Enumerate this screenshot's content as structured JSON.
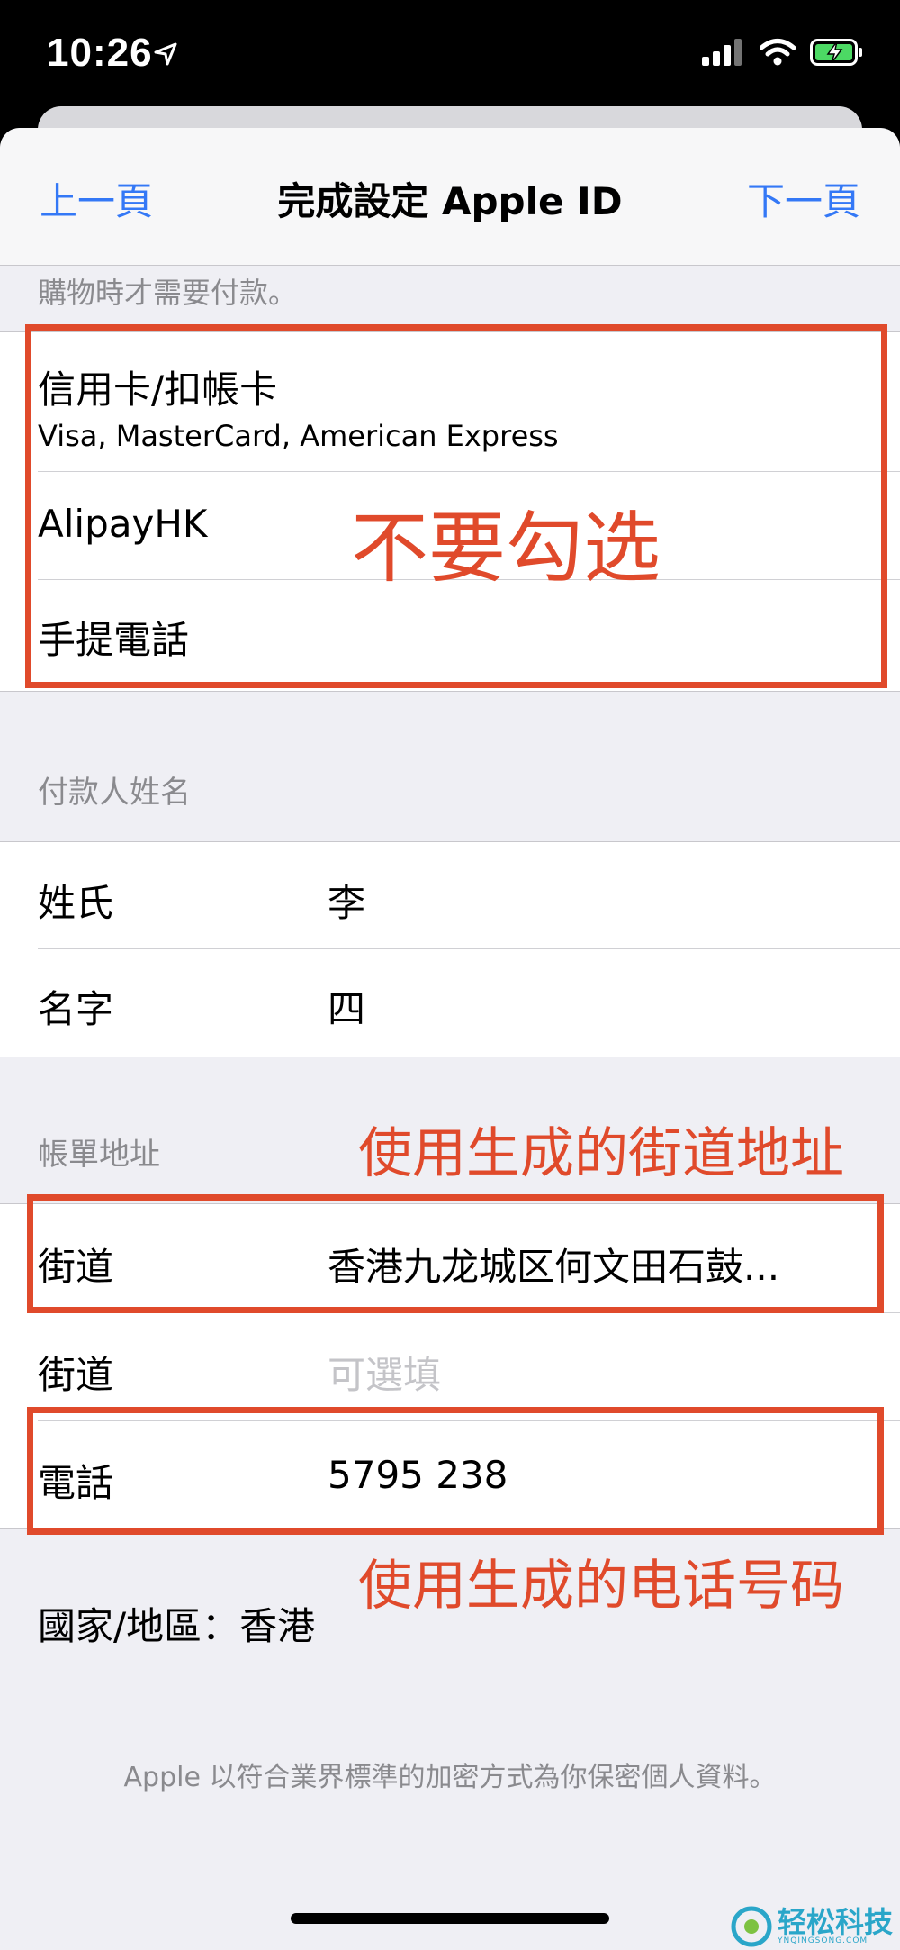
{
  "status_bar": {
    "time": "10:26"
  },
  "navbar": {
    "back_label": "上一頁",
    "title": "完成設定 Apple ID",
    "next_label": "下一頁"
  },
  "payment": {
    "header_cut": "購物時才需要付款。",
    "options": [
      {
        "title": "信用卡/扣帳卡",
        "subtitle": "Visa, MasterCard, American Express"
      },
      {
        "title": "AlipayHK"
      },
      {
        "title": "手提電話"
      }
    ]
  },
  "payer_name": {
    "header": "付款人姓名",
    "rows": [
      {
        "label": "姓氏",
        "value": "李"
      },
      {
        "label": "名字",
        "value": "四"
      }
    ]
  },
  "billing": {
    "header": "帳單地址",
    "rows": [
      {
        "label": "街道",
        "value": "香港九龙城区何文田石鼓..."
      },
      {
        "label": "街道",
        "placeholder": "可選填"
      },
      {
        "label": "電話",
        "value": "5795 238"
      }
    ]
  },
  "country": "國家/地區：香港",
  "footer_note": "Apple 以符合業界標準的加密方式為你保密個人資料。",
  "annotations": {
    "no_check": "不要勾选",
    "use_street": "使用生成的街道地址",
    "use_phone": "使用生成的电话号码"
  },
  "watermark": {
    "text": "轻松科技",
    "sub": "YNQINGSONG.COM"
  },
  "colors": {
    "accent": "#3478f6",
    "annotation": "#e04a2b"
  }
}
